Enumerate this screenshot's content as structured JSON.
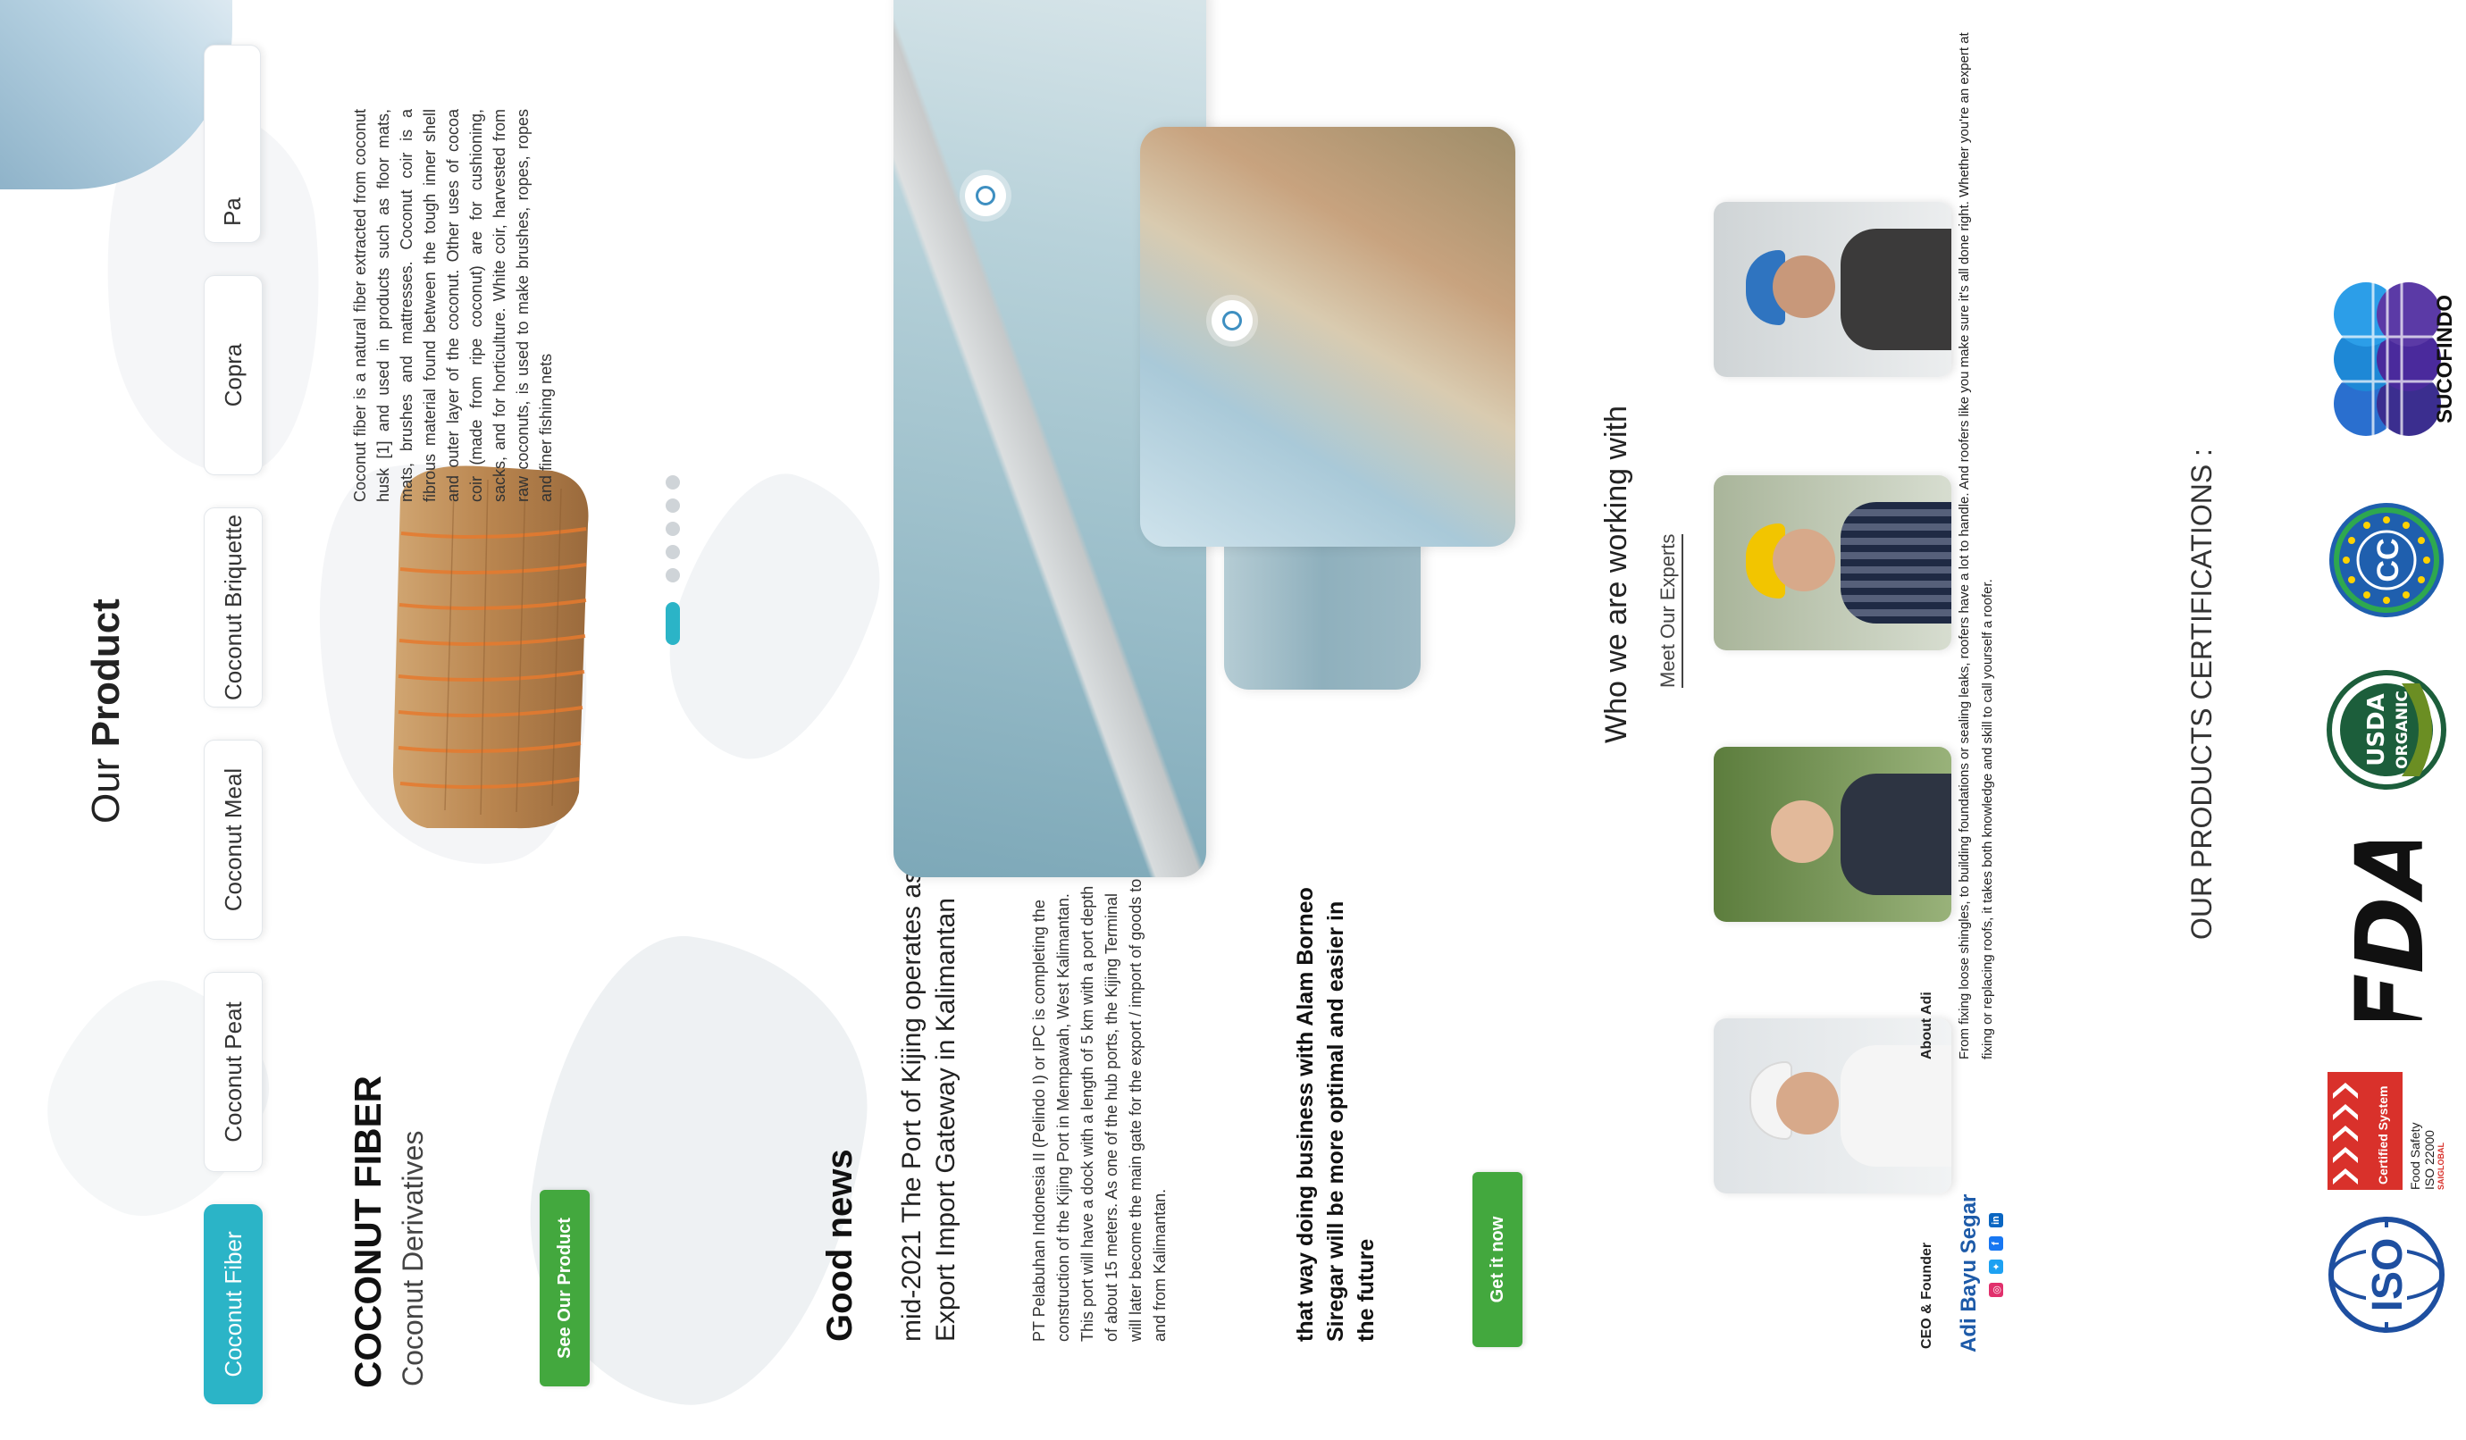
{
  "product_section": {
    "title_prefix": "Our",
    "title_bold": "Product",
    "tabs": [
      {
        "label": "Coconut Fiber",
        "active": true
      },
      {
        "label": "Coconut Peat",
        "active": false
      },
      {
        "label": "Coconut Meal",
        "active": false
      },
      {
        "label": "Coconut Briquette",
        "active": false
      },
      {
        "label": "Copra",
        "active": false
      },
      {
        "label": "Pa",
        "active": false
      }
    ],
    "product_name": "COCONUT FIBER",
    "product_subtitle": "Coconut Derivatives",
    "cta_label": "See Our Product",
    "description": "Coconut fiber is a natural fiber extracted from coconut husk [1] and used in products such as floor mats, mats, brushes and mattresses. Coconut coir is a fibrous material found between the tough inner shell and outer layer of the coconut. Other uses of cocoa coir (made from ripe coconut) are for cushioning, sacks, and for horticulture. White coir, harvested from raw coconuts, is used to make brushes, ropes, ropes and finer fishing nets",
    "carousel": {
      "count": 6,
      "active_index": 5
    }
  },
  "news_section": {
    "title": "Good news",
    "headline": "mid-2021 The Port of Kijing operates as an Export Import Gateway in Kalimantan",
    "body": "PT Pelabuhan Indonesia II (Pelindo I) or IPC is completing the construction of the Kijing Port in Mempawah, West Kalimantan. This port will have a dock with a length of 5 km with a port depth of about 15 meters. As one of the hub ports, the Kijing Terminal will later become the main gate for the export / import of goods to and from Kalimantan.",
    "tagline": "that way doing business with Alam Borneo Siregar will be more optimal and easier in the future",
    "cta_label": "Get it now"
  },
  "team_section": {
    "title": "Who we are working with",
    "subtitle_prefix": "Meet",
    "subtitle_link": "Our Experts",
    "ceo_role": "CEO & Founder",
    "ceo_name": "Adi Bayu Segar",
    "about_label": "About Adi",
    "about_text": "From fixing loose shingles, to building foundations or sealing leaks, roofers have a lot to handle. And roofers like you make sure it's all done right. Whether you're an expert at fixing or replacing roofs, it takes both knowledge and skill to call yourself a roofer.",
    "social_icons": [
      "instagram-icon",
      "twitter-icon",
      "facebook-icon",
      "linkedin-icon"
    ]
  },
  "certifications": {
    "title": "OUR PRODUCTS CERTIFICATIONS :",
    "items": [
      {
        "name": "ISO",
        "kind": "iso-logo"
      },
      {
        "name": "Certified System",
        "kind": "certified-system-logo",
        "line1": "Food Safety",
        "line2": "ISO 22000",
        "line3": "SAIGLOBAL"
      },
      {
        "name": "FDA",
        "kind": "fda-logo"
      },
      {
        "name": "USDA ORGANIC",
        "kind": "usda-organic-logo",
        "line1": "USDA",
        "line2": "ORGANIC"
      },
      {
        "name": "CC",
        "kind": "cc-logo"
      },
      {
        "name": "SUCOFINDO",
        "kind": "sucofindo-logo"
      }
    ]
  },
  "colors": {
    "accent_teal": "#2bb4c7",
    "button_green": "#43a83e",
    "ceo_blue": "#1d5aa8",
    "certified_red": "#d9312b"
  }
}
